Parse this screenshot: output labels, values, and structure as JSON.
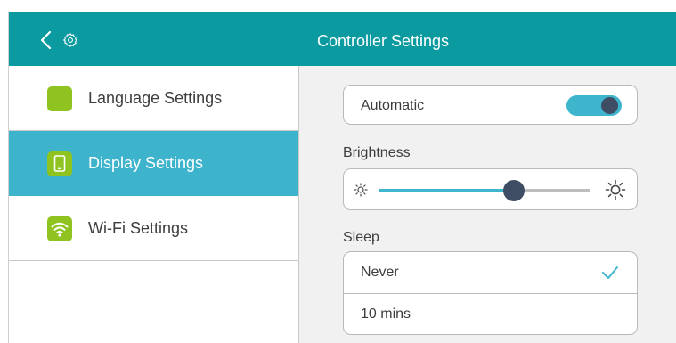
{
  "header": {
    "title": "Controller Settings",
    "back_icon": "chevron-left-icon",
    "settings_icon": "gear-icon"
  },
  "sidebar": {
    "items": [
      {
        "label": "Language Settings",
        "icon": "language-icon",
        "active": false
      },
      {
        "label": "Display Settings",
        "icon": "tablet-icon",
        "active": true
      },
      {
        "label": "Wi-Fi Settings",
        "icon": "wifi-icon",
        "active": false
      }
    ]
  },
  "display": {
    "automatic": {
      "label": "Automatic",
      "enabled": true
    },
    "brightness": {
      "label": "Brightness",
      "value": 0.64
    },
    "sleep": {
      "label": "Sleep",
      "options": [
        {
          "label": "Never",
          "selected": true
        },
        {
          "label": "10 mins",
          "selected": false
        }
      ]
    }
  },
  "colors": {
    "header": "#0a9aa0",
    "active_item": "#3eb3cc",
    "accent": "#3fb4cd",
    "knob": "#3e4d64",
    "icon_green": "#8fc31f"
  }
}
